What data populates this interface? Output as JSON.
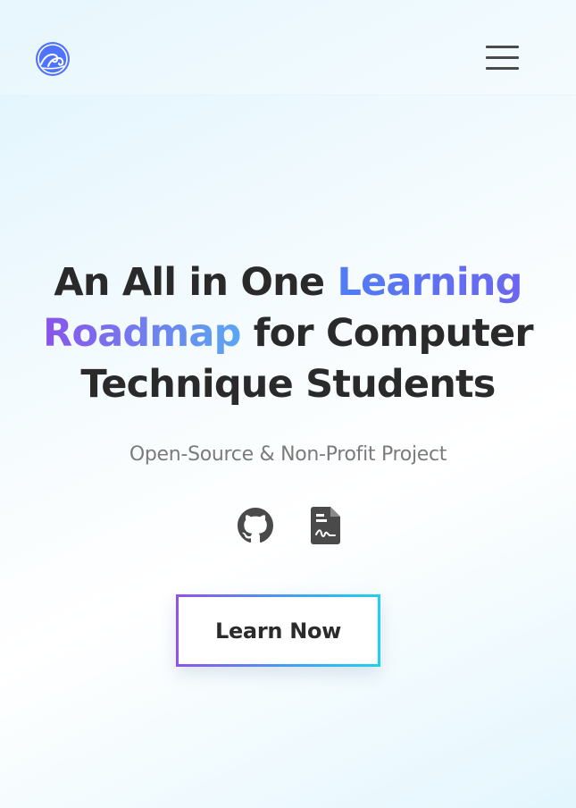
{
  "header": {
    "logo_icon": "wave-logo-icon",
    "menu_icon": "hamburger-menu-icon",
    "brand_color": "#4f72ff"
  },
  "hero": {
    "headline": {
      "part1": "An All in One ",
      "highlight1": "Learning",
      "highlight2": "Roadmap",
      "part2": " for Computer Technique Students"
    },
    "subtitle": "Open-Source & Non-Profit Project",
    "links": [
      {
        "icon": "github-icon"
      },
      {
        "icon": "document-icon"
      }
    ],
    "cta_label": "Learn Now"
  },
  "colors": {
    "text": "#2b2b2b",
    "subtitle": "#7b7b7b",
    "gradient_start": "#9152e8",
    "gradient_end": "#1fd1ee"
  }
}
